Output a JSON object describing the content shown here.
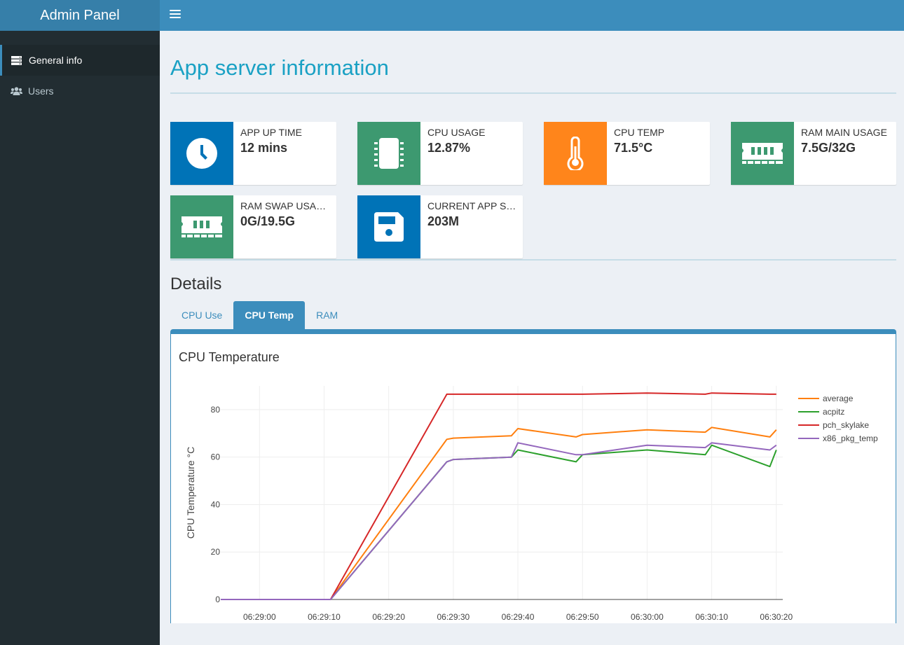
{
  "app": {
    "title": "Admin Panel"
  },
  "sidebar": {
    "items": [
      {
        "label": "General info",
        "icon": "server-icon",
        "active": true
      },
      {
        "label": "Users",
        "icon": "users-icon",
        "active": false
      }
    ]
  },
  "page": {
    "title": "App server information",
    "details_title": "Details"
  },
  "info_boxes": [
    {
      "label": "APP UP TIME",
      "value": "12 mins",
      "color": "#0073b7",
      "icon": "clock-icon"
    },
    {
      "label": "CPU USAGE",
      "value": "12.87%",
      "color": "#3d9970",
      "icon": "chip-icon"
    },
    {
      "label": "CPU TEMP",
      "value": "71.5°C",
      "color": "#ff851b",
      "icon": "thermometer-icon"
    },
    {
      "label": "RAM MAIN USAGE",
      "value": "7.5G/32G",
      "color": "#3d9970",
      "icon": "memory-icon"
    },
    {
      "label": "RAM SWAP USAGE",
      "value": "0G/19.5G",
      "color": "#3d9970",
      "icon": "memory-icon"
    },
    {
      "label": "CURRENT APP SIZE",
      "value": "203M",
      "color": "#0073b7",
      "icon": "floppy-disk-icon"
    }
  ],
  "tabs": [
    {
      "label": "CPU Use",
      "active": false
    },
    {
      "label": "CPU Temp",
      "active": true
    },
    {
      "label": "RAM",
      "active": false
    }
  ],
  "panel": {
    "title": "CPU Temperature"
  },
  "chart_data": {
    "type": "line",
    "title": "CPU Temperature",
    "ylabel": "CPU Temperature °C",
    "xlabel": "",
    "ylim": [
      0,
      90
    ],
    "yticks": [
      0,
      20,
      40,
      60,
      80
    ],
    "xticks": [
      "06:29:00",
      "06:29:10",
      "06:29:20",
      "06:29:30",
      "06:29:40",
      "06:29:50",
      "06:30:00",
      "06:30:10",
      "06:30:20"
    ],
    "xlim": [
      "06:28:54",
      "06:30:21"
    ],
    "grid": true,
    "legend_position": "right",
    "x": [
      "06:28:54",
      "06:29:11",
      "06:29:29",
      "06:29:30",
      "06:29:39",
      "06:29:40",
      "06:29:49",
      "06:29:50",
      "06:30:00",
      "06:30:09",
      "06:30:10",
      "06:30:19",
      "06:30:20"
    ],
    "series": [
      {
        "name": "average",
        "color": "#ff7f0e",
        "values": [
          0,
          0,
          67.5,
          68,
          69,
          72,
          68.5,
          69.5,
          71.5,
          70.5,
          72.5,
          68.5,
          71.5
        ]
      },
      {
        "name": "acpitz",
        "color": "#2ca02c",
        "values": [
          0,
          0,
          58,
          59,
          60,
          63,
          58,
          61,
          63,
          61,
          65,
          56,
          63
        ]
      },
      {
        "name": "pch_skylake",
        "color": "#d62728",
        "values": [
          0,
          0,
          86.5,
          86.5,
          86.5,
          86.5,
          86.5,
          86.5,
          87,
          86.5,
          87,
          86.5,
          86.5
        ]
      },
      {
        "name": "x86_pkg_temp",
        "color": "#9467bd",
        "values": [
          0,
          0,
          58,
          59,
          60,
          66,
          61,
          61,
          65,
          64,
          66,
          63,
          65
        ]
      }
    ]
  }
}
